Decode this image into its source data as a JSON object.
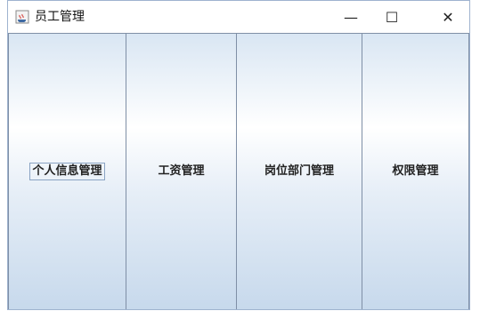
{
  "window": {
    "title": "员工管理",
    "app_icon": "java-coffee-icon",
    "controls": {
      "minimize": "—",
      "maximize": "☐",
      "close": "✕"
    }
  },
  "panel": {
    "buttons": [
      {
        "label": "个人信息管理",
        "focused": true
      },
      {
        "label": "工资管理"
      },
      {
        "label": "岗位部门管理"
      },
      {
        "label": "权限管理"
      }
    ]
  },
  "colors": {
    "border": "#7f8fa6",
    "gradient_top": "#d9e6f3",
    "gradient_mid": "#ffffff",
    "gradient_bottom": "#c7d9ec"
  }
}
